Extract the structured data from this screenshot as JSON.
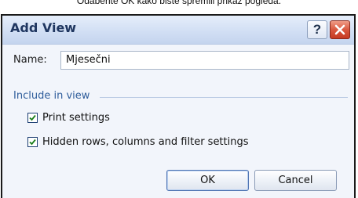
{
  "caption": "Odaberite OK kako biste spremili prikaz pogleda.",
  "dialog": {
    "title": "Add View",
    "help_label": "?",
    "name_label": "Name:",
    "name_value": "Mjesečni",
    "group_title": "Include in view",
    "options": [
      {
        "label": "Print settings",
        "checked": true
      },
      {
        "label": "Hidden rows, columns and filter settings",
        "checked": true
      }
    ],
    "ok_label": "OK",
    "cancel_label": "Cancel"
  },
  "colors": {
    "title_text": "#1f3660",
    "group_title": "#2f5d9b",
    "close_button": "#d9583f"
  },
  "icons": [
    "help-icon",
    "close-icon",
    "checkmark-icon"
  ]
}
